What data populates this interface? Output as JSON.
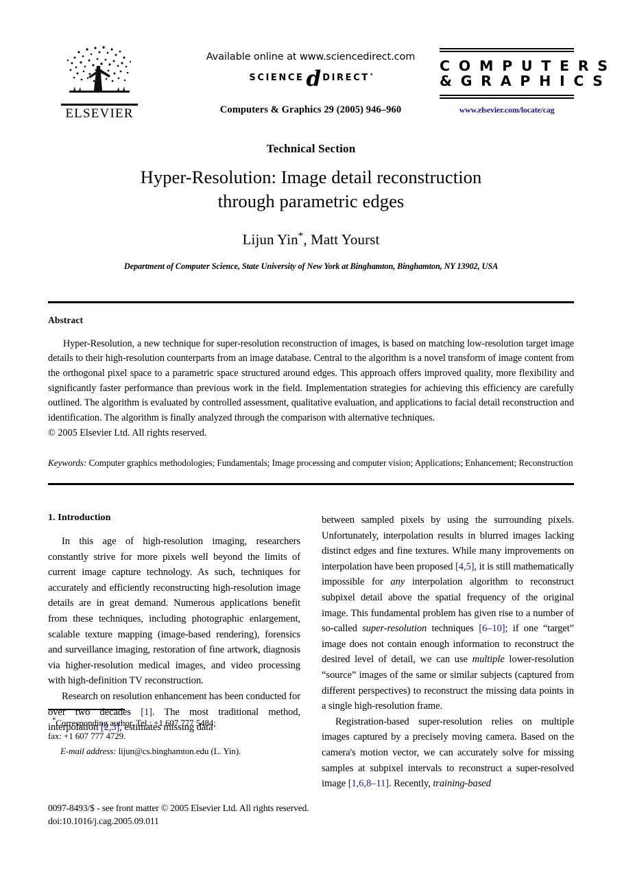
{
  "masthead": {
    "publisher_name": "ELSEVIER",
    "available_online": "Available online at www.sciencedirect.com",
    "sciencedirect": {
      "word1": "SCIENCE",
      "at_glyph": "d",
      "word2": "DIRECT",
      "registered_mark": "•"
    },
    "journal_ref": "Computers & Graphics 29 (2005) 946–960",
    "journal_logo": {
      "line1": "C O M P U T E R S",
      "line2": "& G R A P H I C S",
      "url": "www.elsevier.com/locate/cag",
      "url_color": "#1a1a8c"
    }
  },
  "article": {
    "section_label": "Technical Section",
    "title_line1": "Hyper-Resolution: Image detail reconstruction",
    "title_line2": "through parametric edges",
    "authors": "Lijun Yin",
    "author_marker": "*",
    "authors_rest": ", Matt Yourst",
    "affiliation": "Department of Computer Science, State University of New York at Binghamton, Binghamton, NY 13902, USA"
  },
  "abstract": {
    "heading": "Abstract",
    "body": "Hyper-Resolution, a new technique for super-resolution reconstruction of images, is based on matching low-resolution target image details to their high-resolution counterparts from an image database. Central to the algorithm is a novel transform of image content from the orthogonal pixel space to a parametric space structured around edges. This approach offers improved quality, more flexibility and significantly faster performance than previous work in the field. Implementation strategies for achieving this efficiency are carefully outlined. The algorithm is evaluated by controlled assessment, qualitative evaluation, and applications to facial detail reconstruction and identification. The algorithm is finally analyzed through the comparison with alternative techniques.",
    "copyright": "© 2005 Elsevier Ltd. All rights reserved.",
    "keywords_label": "Keywords:",
    "keywords_value": " Computer graphics methodologies; Fundamentals; Image processing and computer vision; Applications; Enhancement; Reconstruction"
  },
  "body": {
    "section_number_title": "1. Introduction",
    "left_column": {
      "para1": "In this age of high-resolution imaging, researchers constantly strive for more pixels well beyond the limits of current image capture technology. As such, techniques for accurately and efficiently reconstructing high-resolution image details are in great demand. Numerous applications benefit from these techniques, including photographic enlargement, scalable texture mapping (image-based rendering), forensics and surveillance imaging, restoration of fine artwork, diagnosis via higher-resolution medical images, and video processing with high-definition TV reconstruction.",
      "para2_a": "Research on resolution enhancement has been conducted for over two decades ",
      "para2_cite1": "[1]",
      "para2_b": ". The most traditional method, interpolation ",
      "para2_cite2": "[2,3]",
      "para2_c": ", estimates missing data"
    },
    "right_column": {
      "para1_a": "between sampled pixels by using the surrounding pixels. Unfortunately, interpolation results in blurred images lacking distinct edges and fine textures. While many improvements on interpolation have been proposed ",
      "para1_cite1": "[4,5]",
      "para1_b": ", it is still mathematically impossible for ",
      "para1_ital1": "any",
      "para1_c": " interpolation algorithm to reconstruct subpixel detail above the spatial frequency of the original image. This fundamental problem has given rise to a number of so-called ",
      "para1_ital2": "super-resolution",
      "para1_d": " techniques ",
      "para1_cite2": "[6–10]",
      "para1_e": "; if one “target” image does not contain enough information to reconstruct the desired level of detail, we can use ",
      "para1_ital3": "multiple",
      "para1_f": " lower-resolution “source” images of the same or similar subjects (captured from different perspectives) to reconstruct the missing data points in a single high-resolution frame.",
      "para2_a": "Registration-based super-resolution relies on multiple images captured by a precisely moving camera. Based on the camera's motion vector, we can accurately solve for missing samples at subpixel intervals to reconstruct a super-resolved image ",
      "para2_cite1": "[1,6,8–11]",
      "para2_b": ". Recently, ",
      "para2_ital1": "training-based"
    }
  },
  "footnote": {
    "star": "*",
    "line1": "Corresponding author. Tel.: +1 607 777 5484;",
    "line2": "fax: +1 607 777 4729.",
    "email_label": "E-mail address:",
    "email_value": " lijun@cs.binghamton.edu (L. Yin)."
  },
  "page_footer": {
    "line1": "0097-8493/$ - see front matter © 2005 Elsevier Ltd. All rights reserved.",
    "line2": "doi:10.1016/j.cag.2005.09.011"
  }
}
